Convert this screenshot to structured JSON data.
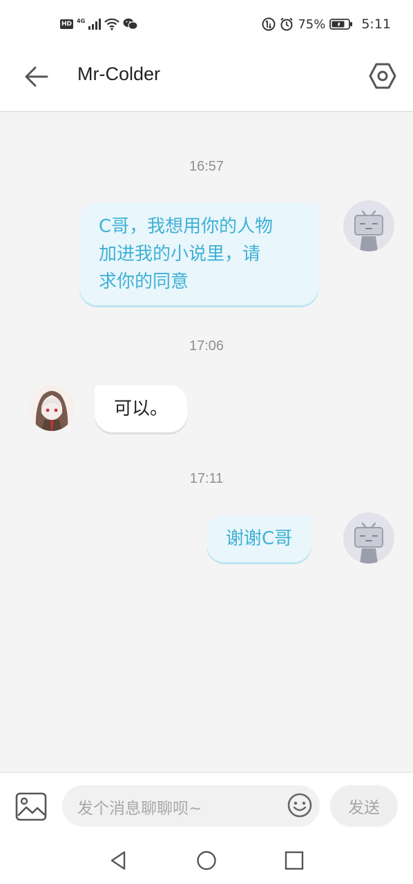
{
  "status_bar": {
    "hd": "HD",
    "network": "4G",
    "battery": "75%",
    "time": "5:11"
  },
  "header": {
    "title": "Mr-Colder"
  },
  "messages": [
    {
      "timestamp": "16:57",
      "sender": "self",
      "text": "C哥，我想用你的人物加进我的小说里，请求你的同意"
    },
    {
      "timestamp": "17:06",
      "sender": "other",
      "text": "可以。"
    },
    {
      "timestamp": "17:11",
      "sender": "self",
      "text": "谢谢C哥"
    }
  ],
  "bubble_lines": {
    "m0": [
      "C哥，我想用你的人物",
      "加进我的小说里，请",
      "求你的同意"
    ]
  },
  "input": {
    "placeholder": "发个消息聊聊呗~",
    "send_label": "发送"
  },
  "colors": {
    "outgoing_text": "#3fb0d6",
    "outgoing_bubble": "#e9f7fc",
    "incoming_bubble": "#ffffff",
    "background": "#f4f4f4"
  },
  "icons": [
    "back-arrow-icon",
    "settings-hexagon-icon",
    "image-icon",
    "emoji-icon",
    "nav-back-icon",
    "nav-home-icon",
    "nav-recents-icon"
  ]
}
